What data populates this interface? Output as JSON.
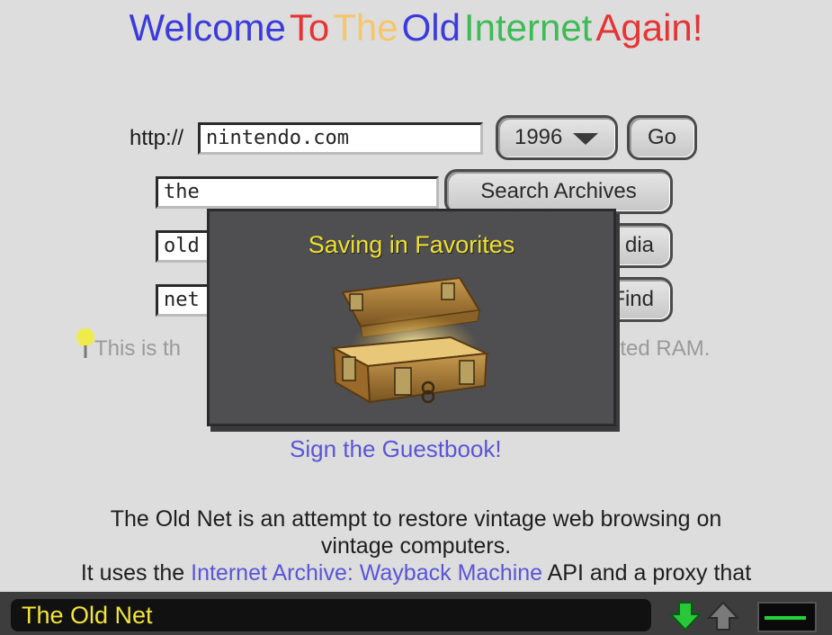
{
  "title": {
    "words": [
      {
        "text": "Welcome",
        "color": "#3b3bdc"
      },
      {
        "text": "To",
        "color": "#e63434"
      },
      {
        "text": "The",
        "color": "#f5c66a"
      },
      {
        "text": "Old",
        "color": "#3b3bdc"
      },
      {
        "text": "Internet",
        "color": "#3dbb55"
      },
      {
        "text": "Again!",
        "color": "#e63434"
      }
    ]
  },
  "url_bar": {
    "prefix": "http://",
    "value": "nintendo.com",
    "year": "1996",
    "go_label": "Go"
  },
  "search": {
    "field1": "the",
    "button1": "Search Archives",
    "field2": "old",
    "button2_visible": "dia",
    "field3": "net",
    "button3_visible": "Find"
  },
  "hint": {
    "left": "This is th",
    "right": "ited RAM."
  },
  "guestbook_link": "Sign the Guestbook!",
  "description": {
    "line1": "The Old Net is an attempt to restore vintage web browsing on",
    "line2": "vintage computers.",
    "line3_pre": "It uses the ",
    "line3_link": "Internet Archive: Wayback Machine",
    "line3_post": " API and a proxy that"
  },
  "modal": {
    "title": "Saving in Favorites",
    "icon": "treasure-chest-icon"
  },
  "status_bar": {
    "title": "The Old Net",
    "download_icon": "green-down-arrow-icon",
    "upload_icon": "gray-up-arrow-icon",
    "progress_fraction": 0.85,
    "progress_color": "#22d33a"
  }
}
